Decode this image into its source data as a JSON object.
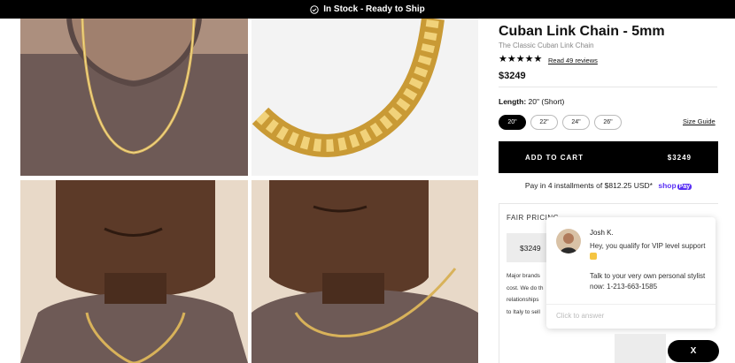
{
  "banner": {
    "text": "In Stock - Ready to Ship",
    "icon": "check-circle-icon"
  },
  "gallery": {
    "images": [
      {
        "name": "model-neck-chain-close"
      },
      {
        "name": "chain-detail-close-up"
      },
      {
        "name": "model-front-chain"
      },
      {
        "name": "model-side-chain"
      }
    ]
  },
  "product": {
    "title": "Cuban Link Chain - 5mm",
    "subtitle": "The Classic Cuban Link Chain",
    "stars": "★★★★★",
    "reviews_link": "Read 49 reviews",
    "price": "$3249"
  },
  "length": {
    "label": "Length:",
    "selected_value": "20\" (Short)",
    "options": [
      "20\"",
      "22\"",
      "24\"",
      "26\""
    ],
    "selected_index": 0,
    "size_guide": "Size Guide"
  },
  "cart": {
    "label": "ADD TO CART",
    "price": "$3249"
  },
  "installments": {
    "text": "Pay in 4 installments of $812.25 USD*",
    "brand": "shop",
    "brand_pay": "Pay"
  },
  "fair_pricing": {
    "title": "FAIR PRICING",
    "price": "$3249",
    "text_lines": [
      "Major brands",
      "cost. We do th",
      "relationships",
      "to Italy to sell"
    ]
  },
  "chat": {
    "agent_name": "Josh K.",
    "message_1": "Hey, you qualify for VIP level support",
    "message_2": "Talk to your very own personal stylist now: 1-213-663-1585",
    "input_placeholder": "Click to answer"
  },
  "close_button": {
    "label": "X"
  },
  "colors": {
    "banner_bg": "#000000",
    "shop_pay": "#5a31f4",
    "gold": "#d8b25a",
    "sweater": "#6e5a56"
  }
}
